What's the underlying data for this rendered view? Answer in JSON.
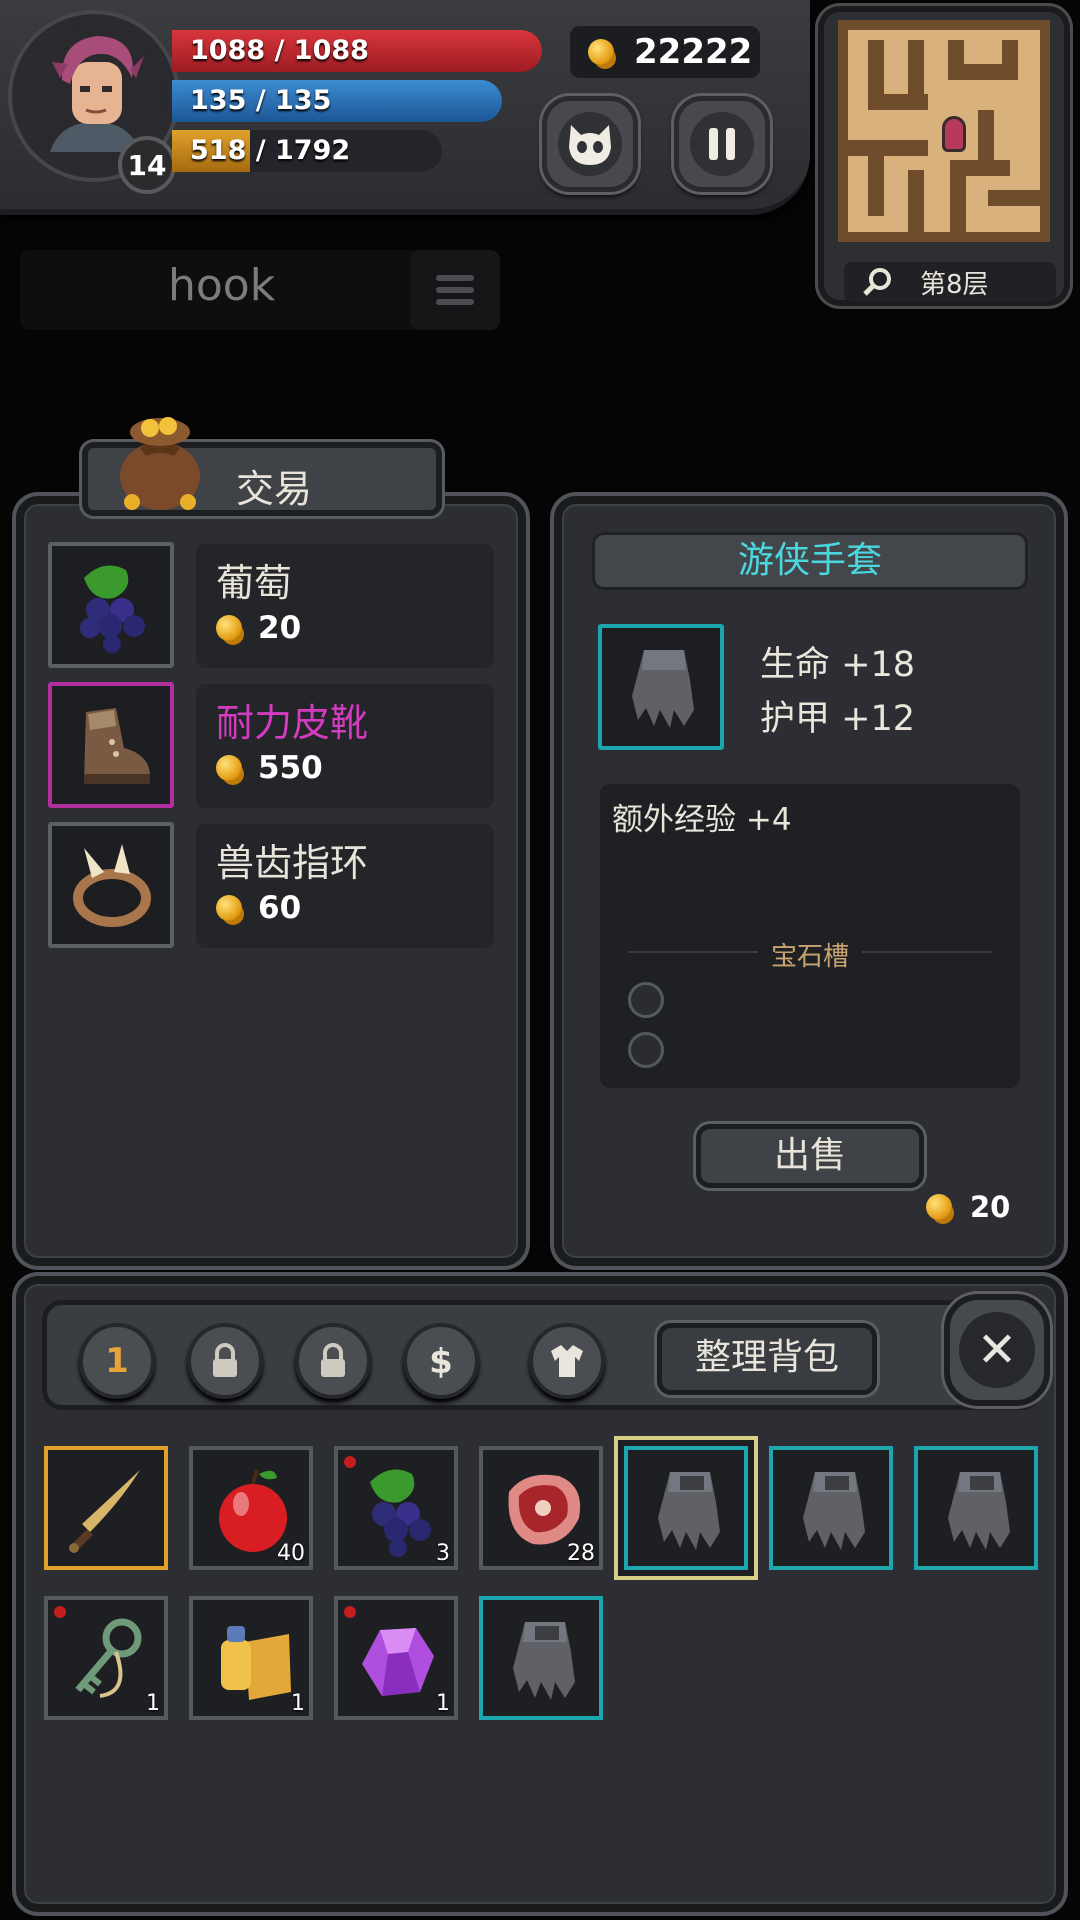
{
  "player": {
    "level": "14",
    "hp_text": "1088 / 1088",
    "mp_text": "135 / 135",
    "xp_text": "518 / 1792",
    "xp_fraction": 0.289,
    "gold": "22222"
  },
  "minimap": {
    "floor_label": "第8层"
  },
  "search": {
    "value": "hook"
  },
  "trade": {
    "title": "交易",
    "items": [
      {
        "name": "葡萄",
        "price": "20",
        "name_color": "#efe8d8",
        "icon": "grapes-icon",
        "rarity": "common"
      },
      {
        "name": "耐力皮靴",
        "price": "550",
        "name_color": "#d33cc0",
        "icon": "leather-boots-icon",
        "rarity": "epic"
      },
      {
        "name": "兽齿指环",
        "price": "60",
        "name_color": "#efe8d8",
        "icon": "fang-ring-icon",
        "rarity": "common"
      }
    ]
  },
  "detail": {
    "title": "游侠手套",
    "stats": [
      "生命 +18",
      "护甲 +12"
    ],
    "extra": "额外经验 +4",
    "gem_label": "宝石槽",
    "sell_label": "出售",
    "sell_price": "20"
  },
  "inventory": {
    "tab_1": "1",
    "sort_label": "整理背包",
    "close_label": "✕",
    "slots": [
      {
        "icon": "curved-sword-icon",
        "count": "",
        "rarity": "legendary",
        "new": false
      },
      {
        "icon": "apple-icon",
        "count": "40",
        "rarity": "common",
        "new": false
      },
      {
        "icon": "grapes-icon",
        "count": "3",
        "rarity": "common",
        "new": true
      },
      {
        "icon": "meat-steak-icon",
        "count": "28",
        "rarity": "common",
        "new": false
      },
      {
        "icon": "gauntlet-icon",
        "count": "",
        "rarity": "rare",
        "new": false,
        "selected": true
      },
      {
        "icon": "gauntlet-icon",
        "count": "",
        "rarity": "rare",
        "new": false
      },
      {
        "icon": "gauntlet-icon",
        "count": "",
        "rarity": "rare",
        "new": false
      },
      {
        "icon": "key-icon",
        "count": "1",
        "rarity": "common",
        "new": true
      },
      {
        "icon": "scroll-potion-icon",
        "count": "1",
        "rarity": "common",
        "new": false
      },
      {
        "icon": "purple-gem-icon",
        "count": "1",
        "rarity": "common",
        "new": true
      },
      {
        "icon": "gauntlet-icon",
        "count": "",
        "rarity": "rare",
        "new": false
      }
    ]
  }
}
